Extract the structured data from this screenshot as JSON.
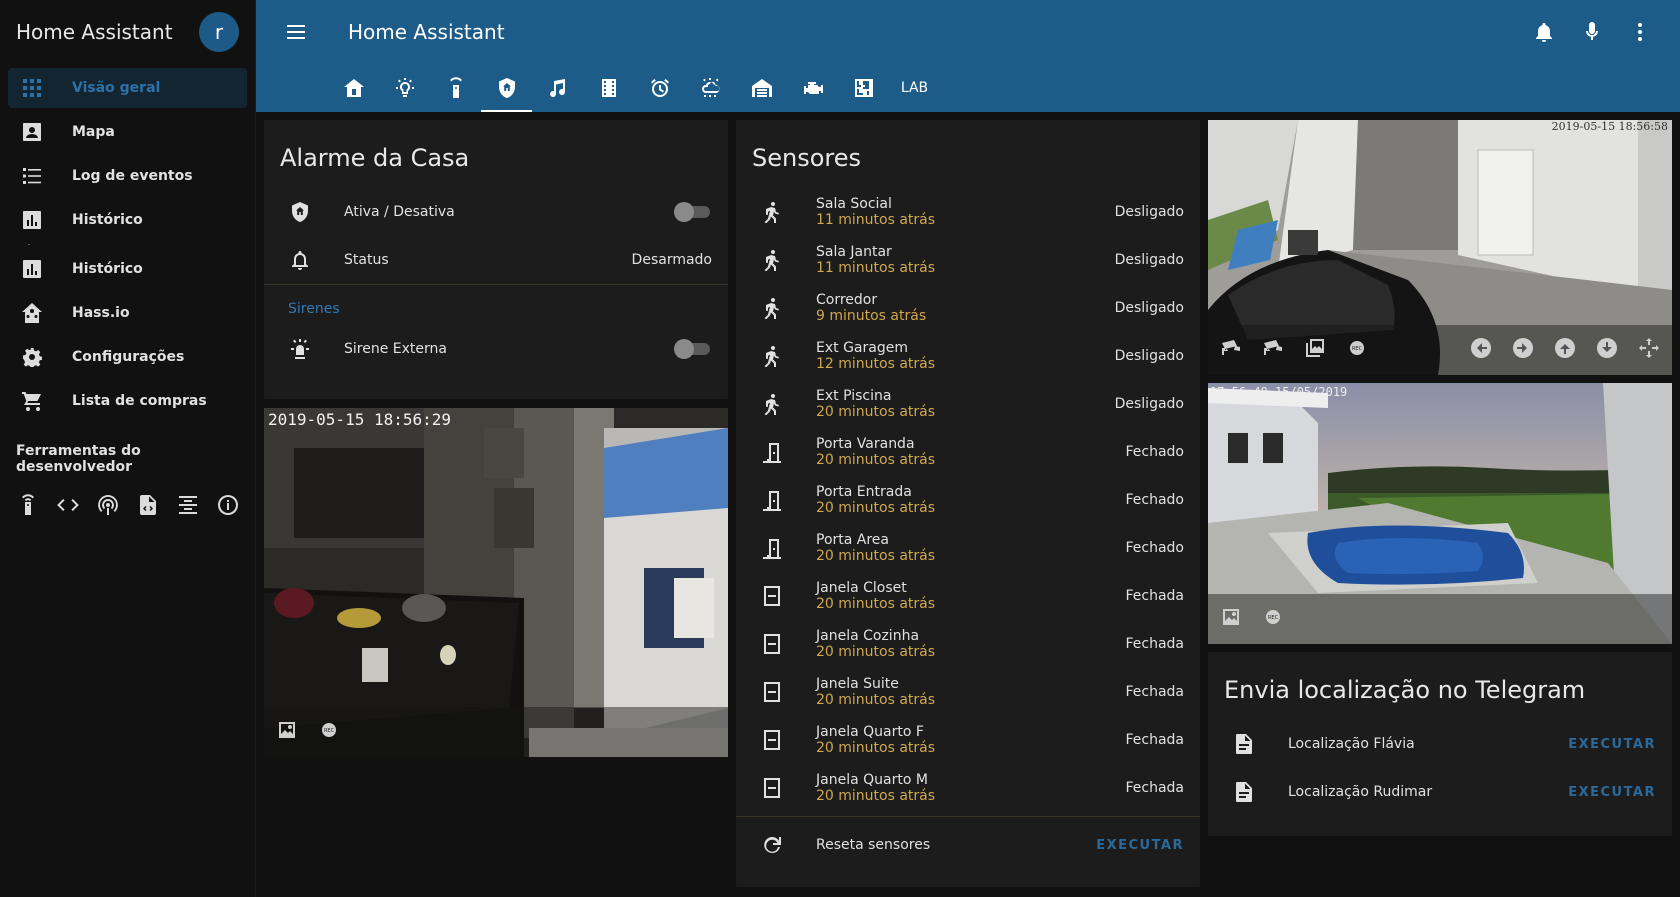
{
  "app": {
    "title": "Home Assistant",
    "avatar_initial": "r"
  },
  "sidebar": {
    "items": [
      {
        "label": "Visão geral",
        "icon": "view-dashboard-icon",
        "active": true
      },
      {
        "label": "Mapa",
        "icon": "account-box-icon"
      },
      {
        "label": "Log de eventos",
        "icon": "format-list-icon"
      },
      {
        "label": "Histórico",
        "icon": "chart-box-icon"
      },
      {
        "label": "Histórico",
        "icon": "chart-box-icon"
      },
      {
        "label": "Hass.io",
        "icon": "home-assistant-icon"
      },
      {
        "label": "Configurações",
        "icon": "settings-icon"
      },
      {
        "label": "Lista de compras",
        "icon": "cart-icon"
      }
    ],
    "dev_title": "Ferramentas do desenvolvedor"
  },
  "topbar": {
    "title": "Home Assistant",
    "lab_tab": "LAB"
  },
  "alarm": {
    "title": "Alarme da Casa",
    "toggle_label": "Ativa / Desativa",
    "status_label": "Status",
    "status_value": "Desarmado",
    "section": "Sirenes",
    "siren_label": "Sirene Externa"
  },
  "sensors": {
    "title": "Sensores",
    "rows": [
      {
        "name": "Sala Social",
        "time": "11 minutos atrás",
        "state": "Desligado",
        "icon": "motion-icon"
      },
      {
        "name": "Sala Jantar",
        "time": "11 minutos atrás",
        "state": "Desligado",
        "icon": "motion-icon"
      },
      {
        "name": "Corredor",
        "time": "9 minutos atrás",
        "state": "Desligado",
        "icon": "motion-icon"
      },
      {
        "name": "Ext Garagem",
        "time": "12 minutos atrás",
        "state": "Desligado",
        "icon": "motion-icon"
      },
      {
        "name": "Ext Piscina",
        "time": "20 minutos atrás",
        "state": "Desligado",
        "icon": "motion-icon"
      },
      {
        "name": "Porta Varanda",
        "time": "20 minutos atrás",
        "state": "Fechado",
        "icon": "door-icon"
      },
      {
        "name": "Porta Entrada",
        "time": "20 minutos atrás",
        "state": "Fechado",
        "icon": "door-icon"
      },
      {
        "name": "Porta Area",
        "time": "20 minutos atrás",
        "state": "Fechado",
        "icon": "door-icon"
      },
      {
        "name": "Janela Closet",
        "time": "20 minutos atrás",
        "state": "Fechada",
        "icon": "window-icon"
      },
      {
        "name": "Janela Cozinha",
        "time": "20 minutos atrás",
        "state": "Fechada",
        "icon": "window-icon"
      },
      {
        "name": "Janela Suite",
        "time": "20 minutos atrás",
        "state": "Fechada",
        "icon": "window-icon"
      },
      {
        "name": "Janela Quarto F",
        "time": "20 minutos atrás",
        "state": "Fechada",
        "icon": "window-icon"
      },
      {
        "name": "Janela Quarto M",
        "time": "20 minutos atrás",
        "state": "Fechada",
        "icon": "window-icon"
      }
    ],
    "reset_label": "Reseta sensores",
    "reset_action": "EXECUTAR"
  },
  "cameras": {
    "kitchen_stamp": "2019-05-15  18:56:29",
    "garage_stamp": "2019-05-15 18:56:58",
    "pool_stamp": "17:56:49 15/05/2019"
  },
  "telegram": {
    "title": "Envia localização no Telegram",
    "rows": [
      {
        "label": "Localização Flávia",
        "action": "EXECUTAR"
      },
      {
        "label": "Localização Rudimar",
        "action": "EXECUTAR"
      }
    ]
  },
  "colors": {
    "header": "#1d5c88",
    "accent": "#2f7ab4",
    "secondary_text": "#d1a74a",
    "card": "#1c1c1c"
  }
}
